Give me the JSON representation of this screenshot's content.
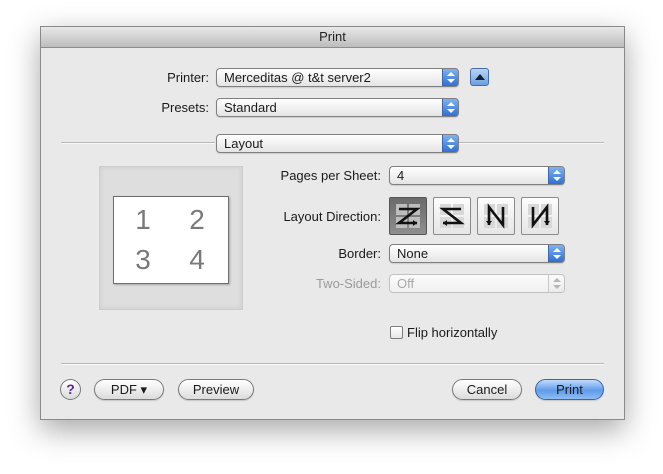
{
  "window": {
    "title": "Print"
  },
  "printer": {
    "label": "Printer:",
    "value": "Merceditas @ t&t server2"
  },
  "presets": {
    "label": "Presets:",
    "value": "Standard"
  },
  "panel": {
    "value": "Layout"
  },
  "preview": {
    "pages": [
      "1",
      "2",
      "3",
      "4"
    ]
  },
  "layout": {
    "pages_per_sheet": {
      "label": "Pages per Sheet:",
      "value": "4"
    },
    "layout_direction": {
      "label": "Layout Direction:",
      "options": [
        "Z",
        "reverse-Z",
        "reverse-N",
        "N"
      ],
      "selected": "Z"
    },
    "border": {
      "label": "Border:",
      "value": "None"
    },
    "two_sided": {
      "label": "Two-Sided:",
      "value": "Off",
      "enabled": false
    },
    "flip": {
      "label": "Flip horizontally",
      "checked": false
    }
  },
  "footer": {
    "help": "?",
    "pdf": "PDF ▾",
    "preview": "Preview",
    "cancel": "Cancel",
    "print": "Print"
  },
  "colors": {
    "accent": "#5f9be8",
    "help_glyph": "#5b2a8c"
  }
}
